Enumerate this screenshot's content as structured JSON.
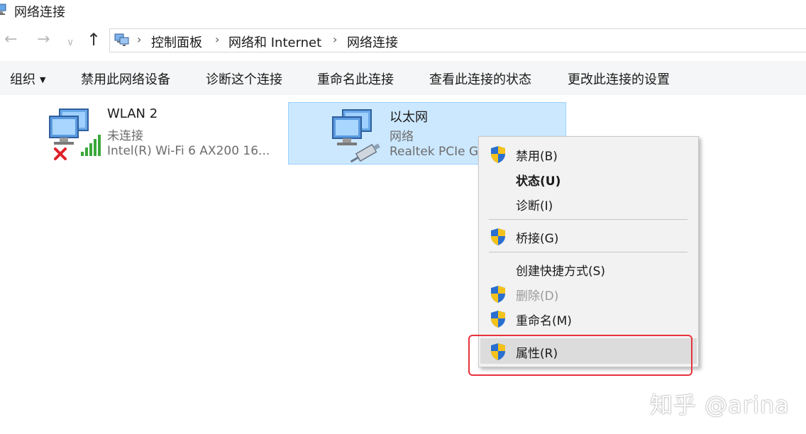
{
  "window": {
    "title": "网络连接"
  },
  "nav": {
    "back_glyph": "←",
    "forward_glyph": "→",
    "recent_glyph": "∨",
    "up_glyph": "↑",
    "breadcrumb": [
      "控制面板",
      "网络和 Internet",
      "网络连接"
    ],
    "separator": "›"
  },
  "toolbar": {
    "items": [
      "组织",
      "禁用此网络设备",
      "诊断这个连接",
      "重命名此连接",
      "查看此连接的状态",
      "更改此连接的设置"
    ],
    "organize_caret": "▼"
  },
  "connections": [
    {
      "name": "WLAN 2",
      "status": "未连接",
      "device": "Intel(R) Wi-Fi 6 AX200 16...",
      "icon": "wifi-network-icon",
      "selected": false
    },
    {
      "name": "以太网",
      "status": "网络",
      "device": "Realtek PCIe GbE Family Controller",
      "icon": "ethernet-network-icon",
      "selected": true
    }
  ],
  "context_menu": {
    "items": [
      {
        "label": "禁用(B)",
        "shield": true,
        "bold": false,
        "disabled": false
      },
      {
        "label": "状态(U)",
        "shield": false,
        "bold": true,
        "disabled": false
      },
      {
        "label": "诊断(I)",
        "shield": false,
        "bold": false,
        "disabled": false
      },
      {
        "label": "桥接(G)",
        "shield": true,
        "bold": false,
        "disabled": false
      },
      {
        "label": "创建快捷方式(S)",
        "shield": false,
        "bold": false,
        "disabled": false
      },
      {
        "label": "删除(D)",
        "shield": true,
        "bold": false,
        "disabled": true
      },
      {
        "label": "重命名(M)",
        "shield": true,
        "bold": false,
        "disabled": false
      },
      {
        "label": "属性(R)",
        "shield": true,
        "bold": false,
        "disabled": false,
        "hovered": true
      }
    ]
  },
  "watermark": "知乎 @arina",
  "colors": {
    "selection_bg": "#cce8ff",
    "selection_border": "#99d1ff",
    "menu_bg": "#f2f2f2",
    "highlight_red": "#e8323c",
    "shield_blue": "#2a6fd0",
    "shield_yellow": "#f5c21b"
  }
}
